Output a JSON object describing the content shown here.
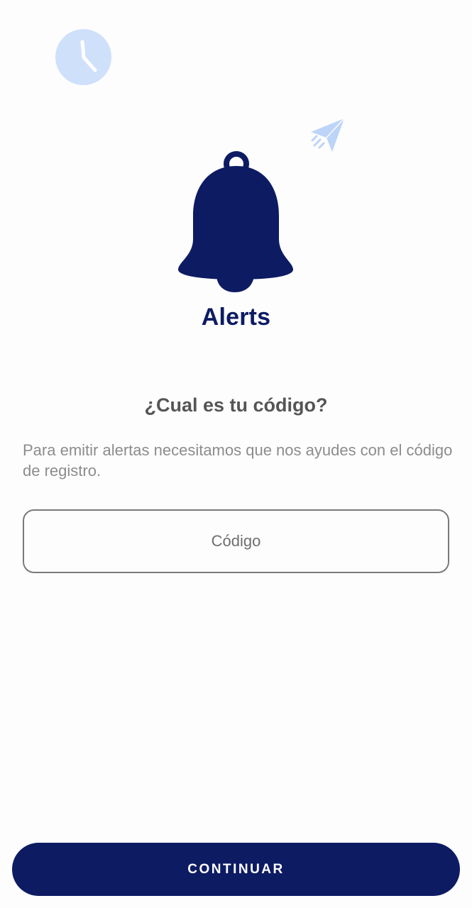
{
  "app": {
    "name": "Alerts"
  },
  "decorations": {
    "clock_icon": "clock-icon",
    "plane_icon": "paper-plane-icon",
    "bell_icon": "bell-icon",
    "accent_light": "#cfe0fb",
    "brand_color": "#0d1b63"
  },
  "content": {
    "question": "¿Cual es tu código?",
    "description": "Para emitir alertas necesitamos que nos ayudes con el código de registro."
  },
  "code_input": {
    "value": "",
    "placeholder": "Código"
  },
  "footer": {
    "continue_label": "CONTINUAR"
  }
}
